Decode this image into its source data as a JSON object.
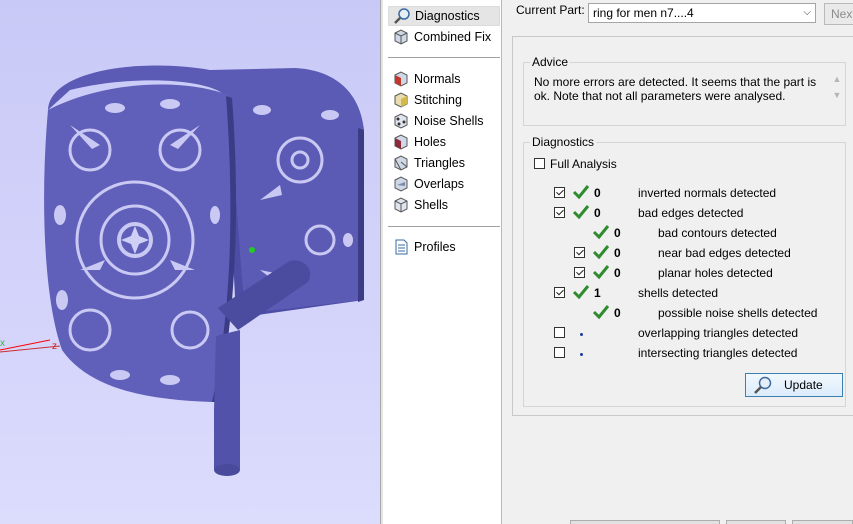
{
  "viewport": {
    "axis": {
      "x_label": "x",
      "z_label": "z",
      "x_color": "#ff0000",
      "z_color": "#e03030"
    },
    "model_color": "#5a5ab4"
  },
  "nav": {
    "items": [
      {
        "label": "Diagnostics",
        "icon": "magnifier-icon",
        "selected": true
      },
      {
        "label": "Combined Fix",
        "icon": "cube-icon"
      },
      {
        "label": "Normals",
        "icon": "normals-cube-icon"
      },
      {
        "label": "Stitching",
        "icon": "stitching-cube-icon"
      },
      {
        "label": "Noise Shells",
        "icon": "noise-shells-icon"
      },
      {
        "label": "Holes",
        "icon": "holes-cube-icon"
      },
      {
        "label": "Triangles",
        "icon": "triangles-cube-icon"
      },
      {
        "label": "Overlaps",
        "icon": "overlaps-cube-icon"
      },
      {
        "label": "Shells",
        "icon": "shells-cube-icon"
      },
      {
        "label": "Profiles",
        "icon": "document-icon"
      }
    ]
  },
  "panel": {
    "current_part_label": "Current Part:",
    "current_part_value": "ring for men n7....4",
    "next_label": "Next",
    "advice": {
      "title": "Advice",
      "text": "No more errors are detected. It seems that the part is ok. Note that not all parameters were analysed."
    },
    "diagnostics": {
      "title": "Diagnostics",
      "full_analysis_label": "Full Analysis",
      "rows": [
        {
          "label": "inverted normals detected",
          "count": "0",
          "checked": true,
          "status": "ok"
        },
        {
          "label": "bad edges detected",
          "count": "0",
          "checked": true,
          "status": "ok"
        },
        {
          "label": "bad contours detected",
          "count": "0",
          "status": "ok"
        },
        {
          "label": "near bad edges detected",
          "count": "0",
          "checked": true,
          "status": "ok"
        },
        {
          "label": "planar holes detected",
          "count": "0",
          "checked": true,
          "status": "ok"
        },
        {
          "label": "shells detected",
          "count": "1",
          "checked": true,
          "status": "ok"
        },
        {
          "label": "possible noise shells detected",
          "count": "0",
          "status": "ok"
        },
        {
          "label": "overlapping triangles detected",
          "count": "",
          "checked": false,
          "status": "pending"
        },
        {
          "label": "intersecting triangles detected",
          "count": "",
          "checked": false,
          "status": "pending"
        }
      ],
      "update_label": "Update"
    }
  },
  "colors": {
    "tick_green": "#2e8b2e",
    "accent_blue": "#3c7fb1"
  }
}
